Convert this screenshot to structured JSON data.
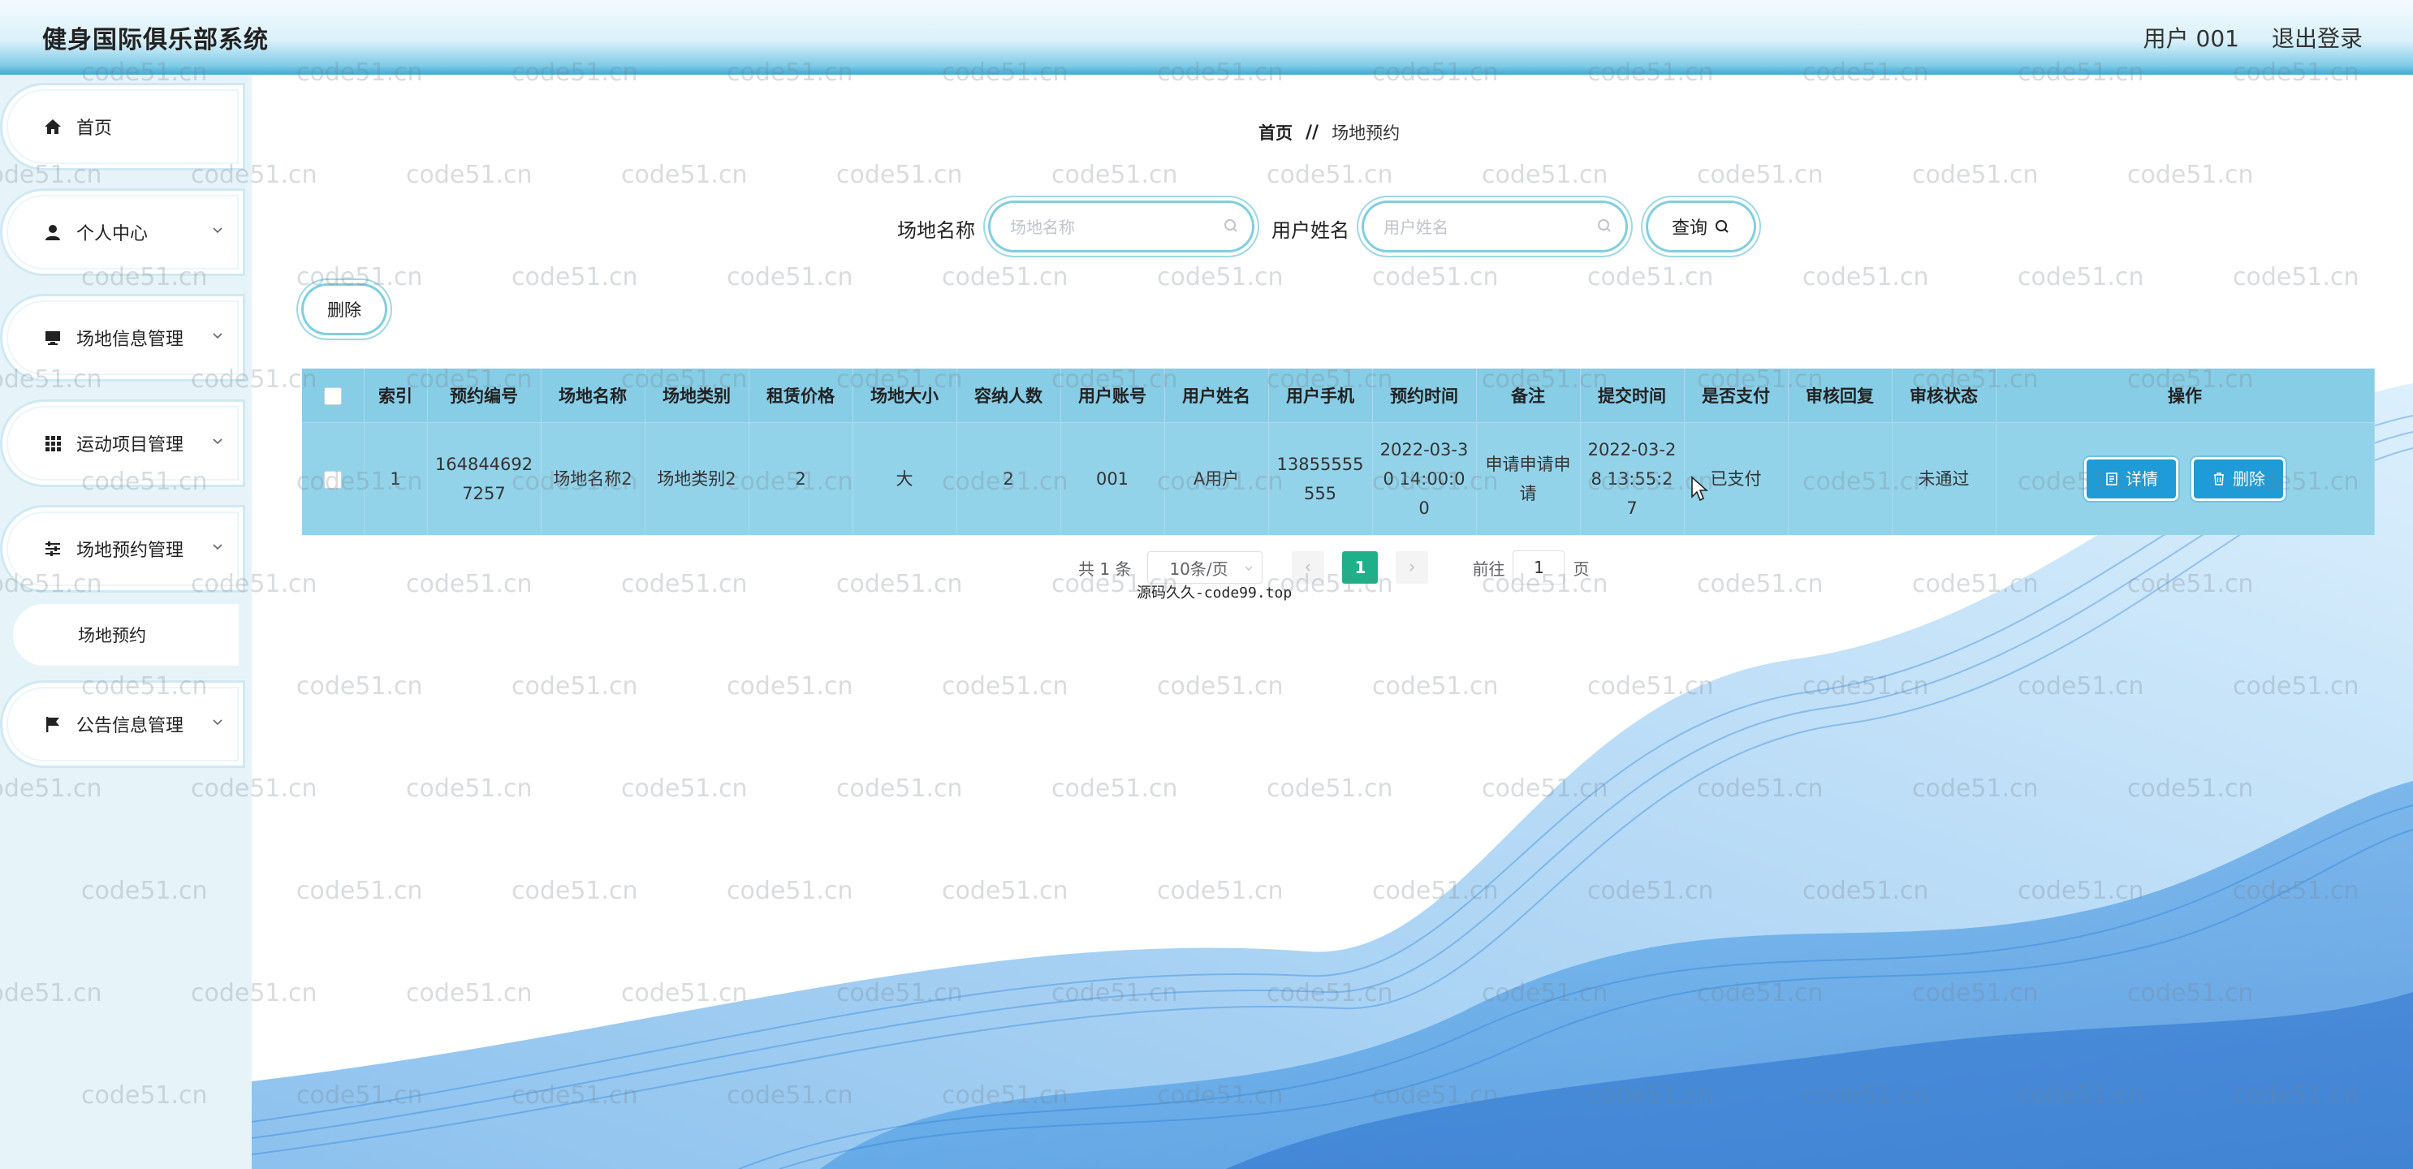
{
  "header": {
    "app_title": "健身国际俱乐部系统",
    "user_label": "用户 001",
    "logout_label": "退出登录"
  },
  "sidebar": {
    "items": [
      {
        "label": "首页",
        "icon": "home-icon"
      },
      {
        "label": "个人中心",
        "icon": "user-icon"
      },
      {
        "label": "场地信息管理",
        "icon": "monitor-icon"
      },
      {
        "label": "运动项目管理",
        "icon": "grid-icon"
      },
      {
        "label": "场地预约管理",
        "icon": "sliders-icon"
      },
      {
        "label": "公告信息管理",
        "icon": "flag-icon"
      }
    ],
    "submenu": {
      "label": "场地预约"
    }
  },
  "breadcrumb": {
    "home": "首页",
    "separator": "//",
    "current": "场地预约"
  },
  "search": {
    "venue_label": "场地名称",
    "venue_placeholder": "场地名称",
    "venue_value": "",
    "user_label": "用户姓名",
    "user_placeholder": "用户姓名",
    "user_value": "",
    "query_label": "查询"
  },
  "toolbar": {
    "delete_label": "删除"
  },
  "table": {
    "headers": [
      "索引",
      "预约编号",
      "场地名称",
      "场地类别",
      "租赁价格",
      "场地大小",
      "容纳人数",
      "用户账号",
      "用户姓名",
      "用户手机",
      "预约时间",
      "备注",
      "提交时间",
      "是否支付",
      "审核回复",
      "审核状态",
      "操作"
    ],
    "rows": [
      {
        "index": "1",
        "booking_no": "1648446927257",
        "venue_name": "场地名称2",
        "venue_type": "场地类别2",
        "price": "2",
        "size": "大",
        "capacity": "2",
        "account": "001",
        "user_name": "A用户",
        "phone": "13855555555",
        "booking_time": "2022-03-30 14:00:00",
        "remark": "申请申请申请",
        "submit_time": "2022-03-28 13:55:27",
        "paid": "已支付",
        "review_reply": "",
        "review_status": "未通过",
        "detail_label": "详情",
        "delete_label": "删除"
      }
    ]
  },
  "pagination": {
    "total_text": "共 1 条",
    "page_size": "10条/页",
    "current_page": "1",
    "goto_prefix": "前往",
    "goto_value": "1",
    "goto_suffix": "页"
  },
  "source_note": "源码久久-code99.top",
  "watermark": "code51.cn",
  "colors": {
    "header_accent": "#3fa7d3",
    "table_header": "#87cde6",
    "table_row": "#93d3ea",
    "action_button": "#1f9bd7",
    "page_active": "#1fb08a"
  }
}
